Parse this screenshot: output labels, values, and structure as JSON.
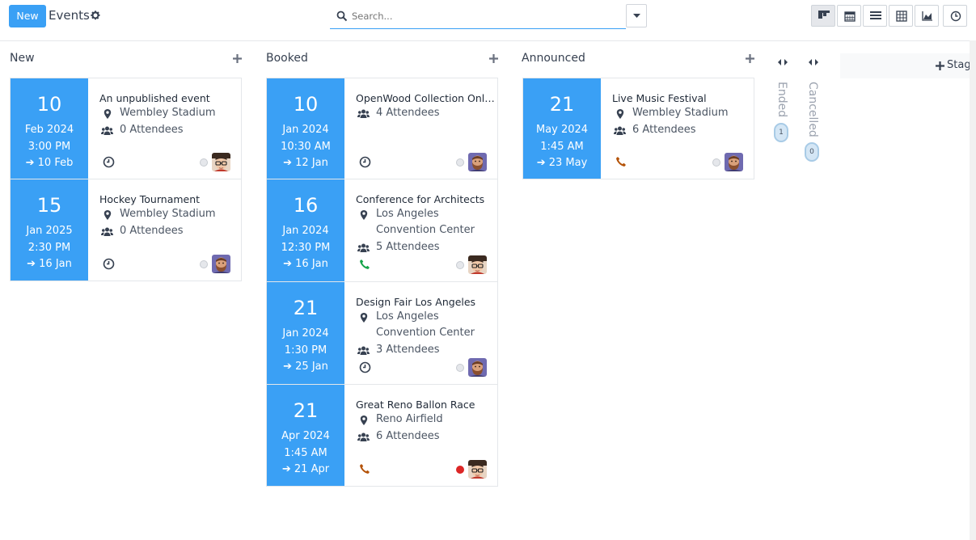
{
  "control_panel": {
    "new_button": "New",
    "breadcrumb": "Events",
    "search_placeholder": "Search..."
  },
  "columns": [
    {
      "title": "New"
    },
    {
      "title": "Booked"
    },
    {
      "title": "Announced"
    }
  ],
  "folded_columns": [
    {
      "label": "Ended",
      "count": "1"
    },
    {
      "label": "Cancelled",
      "count": "0"
    }
  ],
  "add_stage": "Stage",
  "cards": [
    {
      "day": "10",
      "month": "Feb 2024",
      "time": "3:00 PM",
      "end": "➔ 10 Feb",
      "name": "An unpublished event",
      "location": [
        "Wembley Stadium"
      ],
      "attendees": "0 Attendees",
      "activity": "clock",
      "status": "grey",
      "avatar": "glasses"
    },
    {
      "day": "15",
      "month": "Jan 2025",
      "time": "2:30 PM",
      "end": "➔ 16 Jan",
      "name": "Hockey Tournament",
      "location": [
        "Wembley Stadium"
      ],
      "attendees": "0 Attendees",
      "activity": "clock",
      "status": "grey",
      "avatar": "beard"
    },
    {
      "day": "10",
      "month": "Jan 2024",
      "time": "10:30 AM",
      "end": "➔ 12 Jan",
      "name": "OpenWood Collection Onli...",
      "location": [],
      "attendees": "4 Attendees",
      "activity": "clock",
      "status": "grey",
      "avatar": "beard"
    },
    {
      "day": "16",
      "month": "Jan 2024",
      "time": "12:30 PM",
      "end": "➔ 16 Jan",
      "name": "Conference for Architects",
      "location": [
        "Los Angeles",
        "Convention Center"
      ],
      "attendees": "5 Attendees",
      "activity": "phone-green",
      "status": "grey",
      "avatar": "glasses"
    },
    {
      "day": "21",
      "month": "Jan 2024",
      "time": "1:30 PM",
      "end": "➔ 25 Jan",
      "name": "Design Fair Los Angeles",
      "location": [
        "Los Angeles",
        "Convention Center"
      ],
      "attendees": "3 Attendees",
      "activity": "clock",
      "status": "grey",
      "avatar": "beard"
    },
    {
      "day": "21",
      "month": "Apr 2024",
      "time": "1:45 AM",
      "end": "➔ 21 Apr",
      "name": "Great Reno Ballon Race",
      "location": [
        "Reno Airfield"
      ],
      "attendees": "6 Attendees",
      "activity": "phone-orange",
      "status": "red",
      "avatar": "glasses"
    },
    {
      "day": "21",
      "month": "May 2024",
      "time": "1:45 AM",
      "end": "➔ 23 May",
      "name": "Live Music Festival",
      "location": [
        "Wembley Stadium"
      ],
      "attendees": "6 Attendees",
      "activity": "phone-orange",
      "status": "grey",
      "avatar": "beard"
    }
  ],
  "colors": {
    "accent": "#3aa0f5",
    "status_red": "#dc2626",
    "phone_green": "#16a34a",
    "phone_orange": "#b45309"
  }
}
